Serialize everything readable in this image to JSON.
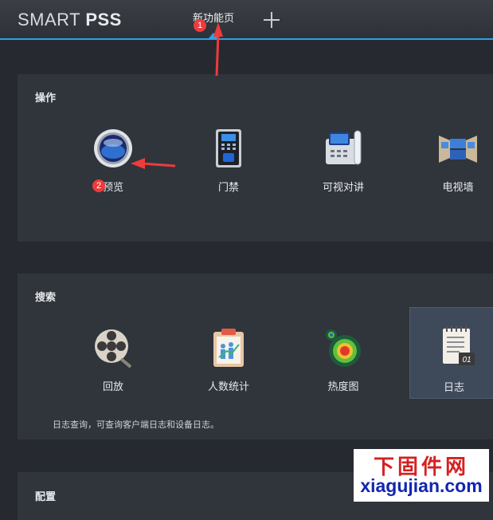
{
  "app": {
    "logo_light": "SMART ",
    "logo_bold": "PSS"
  },
  "tabs": [
    {
      "label": "新功能页",
      "active": true
    }
  ],
  "sections": {
    "operation": {
      "title": "操作",
      "items": [
        {
          "label": "预览",
          "icon": "camera-lens-icon"
        },
        {
          "label": "门禁",
          "icon": "access-control-icon"
        },
        {
          "label": "可视对讲",
          "icon": "video-intercom-phone-icon"
        },
        {
          "label": "电视墙",
          "icon": "tv-wall-icon"
        }
      ]
    },
    "search": {
      "title": "搜索",
      "items": [
        {
          "label": "回放",
          "icon": "film-reel-icon"
        },
        {
          "label": "人数统计",
          "icon": "people-counting-icon"
        },
        {
          "label": "热度图",
          "icon": "heat-map-icon"
        },
        {
          "label": "日志",
          "icon": "log-notepad-icon",
          "selected": true
        }
      ],
      "description": "日志查询，可查询客户端日志和设备日志。"
    },
    "config": {
      "title": "配置"
    }
  },
  "annotations": {
    "marker1": "1",
    "marker2": "2",
    "color": "#ee3b3b"
  },
  "watermark": {
    "line1": "下固件网",
    "line2": "xiagujian.com"
  },
  "colors": {
    "accent": "#2aa2e8",
    "background": "#262a30",
    "panel": "#30343b"
  }
}
